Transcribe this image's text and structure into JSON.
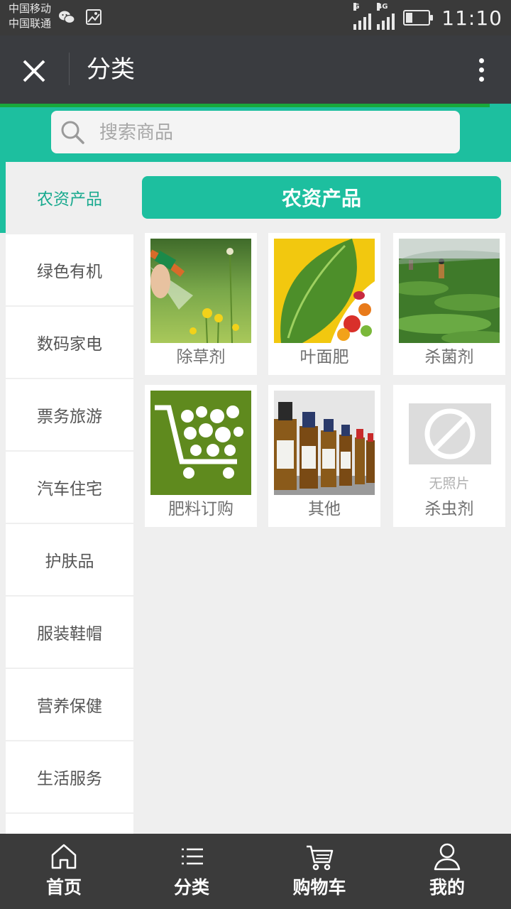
{
  "status_bar": {
    "carrier1": "中国移动",
    "carrier2": "中国联通",
    "net1": "G",
    "net2": "4G",
    "time": "11:10"
  },
  "header": {
    "title": "分类"
  },
  "search": {
    "placeholder": "搜索商品"
  },
  "sidebar": {
    "items": [
      {
        "label": "农资产品",
        "active": true
      },
      {
        "label": "绿色有机"
      },
      {
        "label": "数码家电"
      },
      {
        "label": "票务旅游"
      },
      {
        "label": "汽车住宅"
      },
      {
        "label": "护肤品"
      },
      {
        "label": "服装鞋帽"
      },
      {
        "label": "营养保健"
      },
      {
        "label": "生活服务"
      }
    ]
  },
  "content": {
    "banner": "农资产品",
    "products": [
      {
        "label": "除草剂",
        "image": "herbicide-spray-photo"
      },
      {
        "label": "叶面肥",
        "image": "leaf-fertilizer-photo"
      },
      {
        "label": "杀菌剂",
        "image": "fungicide-field-photo"
      },
      {
        "label": "肥料订购",
        "image": "fertilizer-cart-graphic"
      },
      {
        "label": "其他",
        "image": "chemical-bottles-photo"
      },
      {
        "label": "杀虫剂",
        "image": "no-photo-placeholder",
        "placeholder_text": "无照片"
      }
    ]
  },
  "tabbar": {
    "tabs": [
      {
        "label": "首页",
        "icon": "home-icon"
      },
      {
        "label": "分类",
        "icon": "list-icon"
      },
      {
        "label": "购物车",
        "icon": "cart-icon"
      },
      {
        "label": "我的",
        "icon": "user-icon"
      }
    ]
  },
  "colors": {
    "accent": "#1dbf9f",
    "titlebar": "#3a3c40",
    "tabbar": "#3b3b3b"
  }
}
